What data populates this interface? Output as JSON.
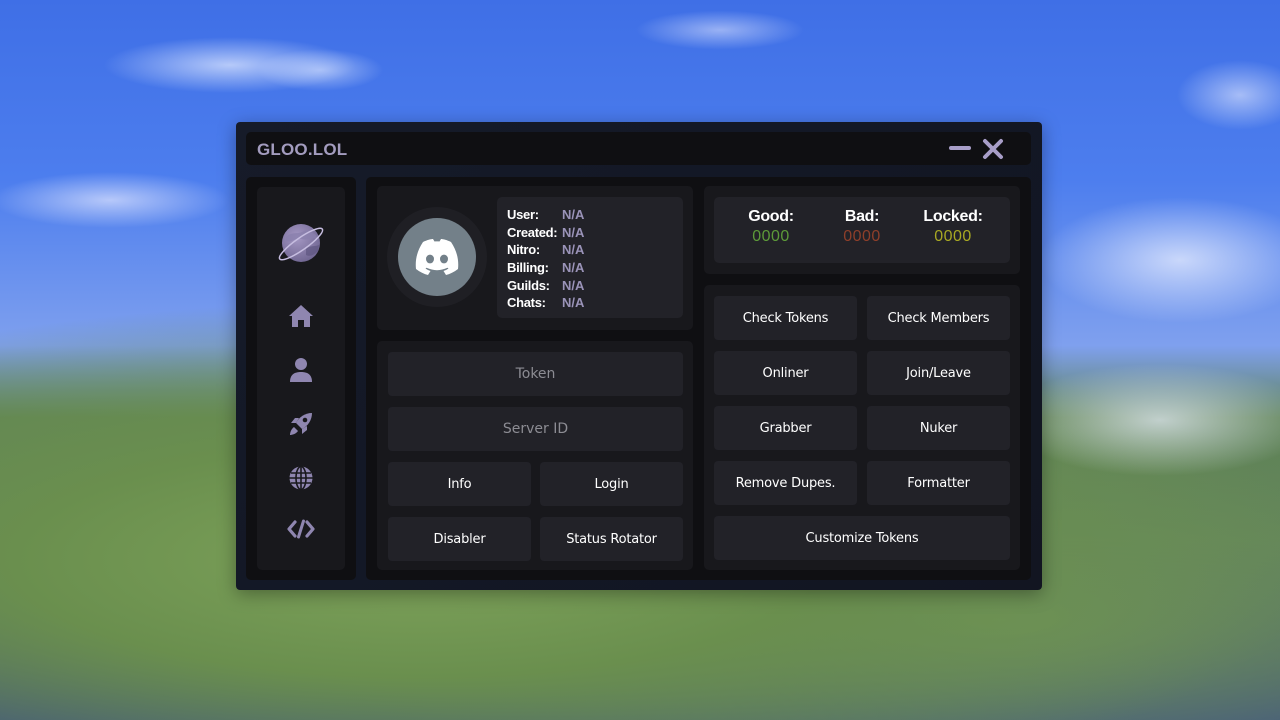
{
  "window": {
    "title": "GLOO.LOL",
    "controls": {
      "minimize": "minimize-icon",
      "close": "close-icon"
    }
  },
  "sidebar": {
    "logo": "planet-logo-icon",
    "items": [
      {
        "name": "home",
        "icon": "home-icon"
      },
      {
        "name": "user",
        "icon": "user-icon"
      },
      {
        "name": "rocket",
        "icon": "rocket-icon"
      },
      {
        "name": "globe",
        "icon": "globe-icon"
      },
      {
        "name": "code",
        "icon": "code-icon"
      }
    ]
  },
  "profile": {
    "avatar_icon": "discord-icon",
    "fields": [
      {
        "label": "User:",
        "value": "N/A"
      },
      {
        "label": "Created:",
        "value": "N/A"
      },
      {
        "label": "Nitro:",
        "value": "N/A"
      },
      {
        "label": "Billing:",
        "value": "N/A"
      },
      {
        "label": "Guilds:",
        "value": "N/A"
      },
      {
        "label": "Chats:",
        "value": "N/A"
      }
    ]
  },
  "stats": {
    "good": {
      "label": "Good:",
      "value": "0000",
      "color": "#5d9a39"
    },
    "bad": {
      "label": "Bad:",
      "value": "0000",
      "color": "#8e3f2a"
    },
    "locked": {
      "label": "Locked:",
      "value": "0000",
      "color": "#a8a823"
    }
  },
  "inputs": {
    "token": {
      "placeholder": "Token",
      "value": ""
    },
    "server_id": {
      "placeholder": "Server ID",
      "value": ""
    }
  },
  "left_buttons": {
    "info": "Info",
    "login": "Login",
    "disabler": "Disabler",
    "status_rotator": "Status Rotator"
  },
  "action_buttons": {
    "check_tokens": "Check Tokens",
    "check_members": "Check Members",
    "onliner": "Onliner",
    "join_leave": "Join/Leave",
    "grabber": "Grabber",
    "nuker": "Nuker",
    "remove_dupes": "Remove Dupes.",
    "formatter": "Formatter",
    "customize_tokens": "Customize Tokens"
  },
  "colors": {
    "accent": "#a89ec8",
    "panel": "#18181c",
    "button": "#222228"
  }
}
